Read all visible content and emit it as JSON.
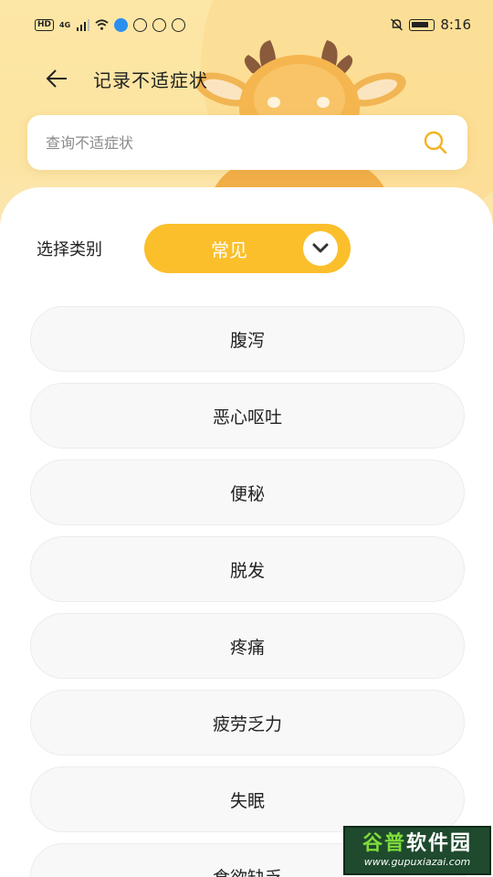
{
  "status_bar": {
    "left_badge": "HD",
    "network": "4G",
    "time": "8:16"
  },
  "nav": {
    "title": "记录不适症状"
  },
  "search": {
    "placeholder": "查询不适症状",
    "value": ""
  },
  "category": {
    "label": "选择类别",
    "selected": "常见"
  },
  "symptoms": [
    {
      "label": "腹泻"
    },
    {
      "label": "恶心呕吐"
    },
    {
      "label": "便秘"
    },
    {
      "label": "脱发"
    },
    {
      "label": "疼痛"
    },
    {
      "label": "疲劳乏力"
    },
    {
      "label": "失眠"
    },
    {
      "label": "食欲缺乏"
    }
  ],
  "watermark": {
    "logo_a": "谷普",
    "logo_b": "软件园",
    "url": "www.gupuxiazai.com"
  },
  "colors": {
    "accent": "#fbbf2b",
    "header_bg": "#fde7a6"
  }
}
